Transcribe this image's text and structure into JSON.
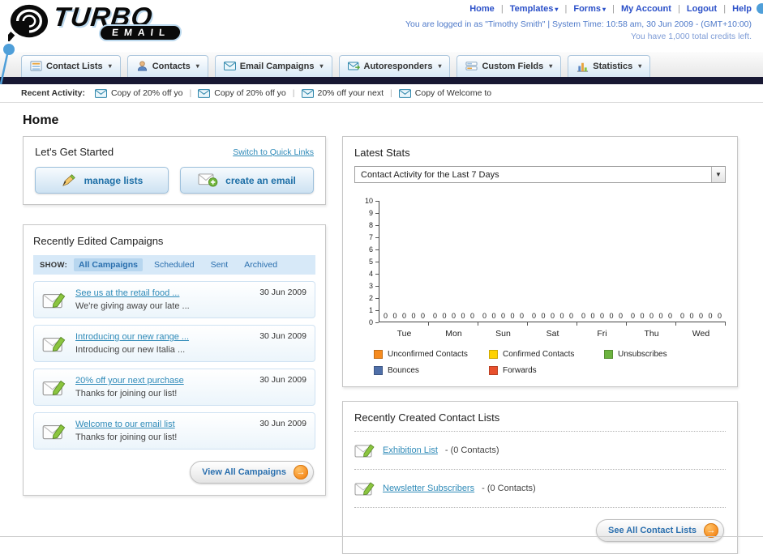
{
  "icons": {
    "dropdown_arrow": "▾",
    "select_arrow": "▼",
    "button_arrow": "→",
    "separator": "|"
  },
  "logo": {
    "line1": "TURBO",
    "line2": "EMAIL"
  },
  "header": {
    "nav": [
      "Home",
      "Templates",
      "Forms",
      "My Account",
      "Logout",
      "Help"
    ],
    "session": "You are logged in as \"Timothy Smith\" | System Time: 10:58 am, 30 Jun 2009 - (GMT+10:00)",
    "credits": "You have 1,000 total credits left."
  },
  "tabs": [
    {
      "label": "Contact Lists"
    },
    {
      "label": "Contacts"
    },
    {
      "label": "Email Campaigns"
    },
    {
      "label": "Autoresponders"
    },
    {
      "label": "Custom Fields"
    },
    {
      "label": "Statistics"
    }
  ],
  "recent_activity": {
    "label": "Recent Activity:",
    "items": [
      "Copy of 20% off yo",
      "Copy of 20% off yo",
      "20% off your next",
      "Copy of Welcome to"
    ]
  },
  "page_title": "Home",
  "get_started": {
    "title": "Let's Get Started",
    "switch_link": "Switch to Quick Links",
    "manage_lists": "manage lists",
    "create_email": "create an email"
  },
  "campaigns": {
    "title": "Recently Edited Campaigns",
    "show_label": "SHOW:",
    "filters": [
      "All Campaigns",
      "Scheduled",
      "Sent",
      "Archived"
    ],
    "items": [
      {
        "title": "See us at the retail food ...",
        "subtitle": "We're giving away our late ...",
        "date": "30 Jun 2009"
      },
      {
        "title": "Introducing our new range ...",
        "subtitle": "Introducing our new Italia ...",
        "date": "30 Jun 2009"
      },
      {
        "title": "20% off your next purchase",
        "subtitle": "Thanks for joining our list!",
        "date": "30 Jun 2009"
      },
      {
        "title": "Welcome to our email list",
        "subtitle": "Thanks for joining our list!",
        "date": "30 Jun 2009"
      }
    ],
    "view_all": "View All Campaigns"
  },
  "stats": {
    "title": "Latest Stats",
    "selector_value": "Contact Activity for the Last 7 Days"
  },
  "chart_data": {
    "type": "bar",
    "title": "Contact Activity for the Last 7 Days",
    "categories": [
      "Tue",
      "Mon",
      "Sun",
      "Sat",
      "Fri",
      "Thu",
      "Wed"
    ],
    "series": [
      {
        "name": "Unconfirmed Contacts",
        "color": "#f68b1f",
        "values": [
          0,
          0,
          0,
          0,
          0,
          0,
          0
        ]
      },
      {
        "name": "Confirmed Contacts",
        "color": "#ffd200",
        "values": [
          0,
          0,
          0,
          0,
          0,
          0,
          0
        ]
      },
      {
        "name": "Unsubscribes",
        "color": "#6cb33f",
        "values": [
          0,
          0,
          0,
          0,
          0,
          0,
          0
        ]
      },
      {
        "name": "Bounces",
        "color": "#4f6fa8",
        "values": [
          0,
          0,
          0,
          0,
          0,
          0,
          0
        ]
      },
      {
        "name": "Forwards",
        "color": "#e8502d",
        "values": [
          0,
          0,
          0,
          0,
          0,
          0,
          0
        ]
      }
    ],
    "ylim": [
      0,
      10
    ],
    "ytick_step": 1,
    "grid": false,
    "legend_position": "bottom",
    "show_value_labels": true
  },
  "contact_lists": {
    "title": "Recently Created Contact Lists",
    "items": [
      {
        "name": "Exhibition List",
        "count": "- (0 Contacts)"
      },
      {
        "name": "Newsletter Subscribers",
        "count": "- (0 Contacts)"
      }
    ],
    "see_all": "See All Contact Lists"
  }
}
